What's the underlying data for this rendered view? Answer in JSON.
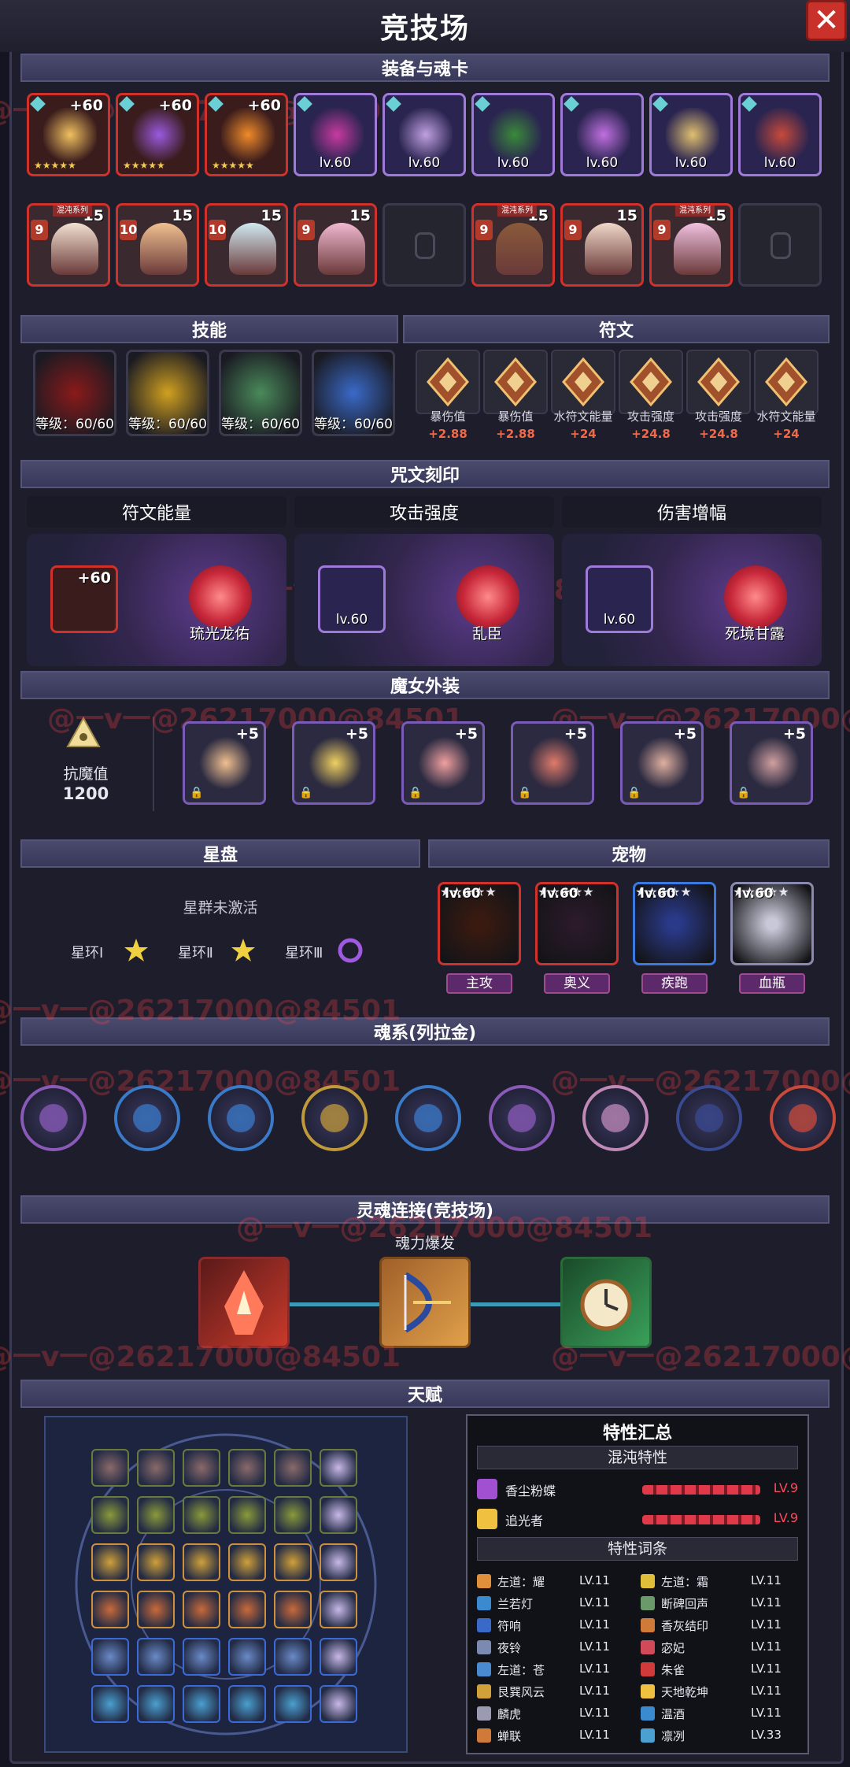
{
  "title": "竞技场",
  "colors": {
    "accent_red": "#d0312a",
    "panel": "#1d1d2b",
    "section_header": "#4a4a6c"
  },
  "sections": {
    "equipment": "装备与魂卡",
    "skills": "技能",
    "runes": "符文",
    "engraving": "咒文刻印",
    "costume": "魔女外装",
    "star_disk": "星盘",
    "pet": "宠物",
    "soul_system": "魂系(列拉金)",
    "soul_link": "灵魂连接(竞技场)",
    "talent": "天赋"
  },
  "equipment": [
    {
      "kind": "weapon",
      "label": "+60"
    },
    {
      "kind": "orb",
      "label": "+60"
    },
    {
      "kind": "flame",
      "label": "+60"
    },
    {
      "kind": "staff",
      "label": "lv.60"
    },
    {
      "kind": "axe",
      "label": "lv.60"
    },
    {
      "kind": "warrior",
      "label": "lv.60"
    },
    {
      "kind": "potion",
      "label": "lv.60"
    },
    {
      "kind": "ring",
      "label": "lv.60"
    },
    {
      "kind": "boot",
      "label": "lv.60"
    }
  ],
  "heroes": [
    {
      "rank": "9",
      "count": "15",
      "tag": "混沌系列"
    },
    {
      "rank": "10",
      "count": "15",
      "tag": ""
    },
    {
      "rank": "10",
      "count": "15",
      "tag": ""
    },
    {
      "rank": "9",
      "count": "15",
      "tag": ""
    },
    {
      "rank": "",
      "count": "",
      "tag": ""
    },
    {
      "rank": "9",
      "count": "15",
      "tag": "混沌系列"
    },
    {
      "rank": "9",
      "count": "15",
      "tag": ""
    },
    {
      "rank": "9",
      "count": "15",
      "tag": "混沌系列"
    },
    {
      "rank": "",
      "count": "",
      "tag": ""
    }
  ],
  "skills": [
    {
      "level": "等级：60/60"
    },
    {
      "level": "等级：60/60"
    },
    {
      "level": "等级：60/60"
    },
    {
      "level": "等级：60/60"
    }
  ],
  "runes": [
    {
      "name": "暴伤值",
      "value": "+2.88"
    },
    {
      "name": "暴伤值",
      "value": "+2.88"
    },
    {
      "name": "水符文能量",
      "value": "+24"
    },
    {
      "name": "攻击强度",
      "value": "+24.8"
    },
    {
      "name": "攻击强度",
      "value": "+24.8"
    },
    {
      "name": "水符文能量",
      "value": "+24"
    }
  ],
  "engravings": [
    {
      "header": "符文能量",
      "item_label": "+60",
      "seal": "琉光龙佑"
    },
    {
      "header": "攻击强度",
      "item_label": "lv.60",
      "seal": "乱臣"
    },
    {
      "header": "伤害增幅",
      "item_label": "lv.60",
      "seal": "死境甘露"
    }
  ],
  "costume": {
    "resist_label": "抗魔值",
    "resist_value": "1200",
    "items": [
      "+5",
      "+5",
      "+5",
      "+5",
      "+5",
      "+5"
    ]
  },
  "star_disk": {
    "status": "星群未激活",
    "rings": [
      "星环Ⅰ",
      "星环Ⅱ",
      "星环Ⅲ"
    ]
  },
  "pets": [
    {
      "level": "lv.60",
      "tag": "主攻"
    },
    {
      "level": "lv.60",
      "tag": "奥义"
    },
    {
      "level": "lv.60",
      "tag": "疾跑"
    },
    {
      "level": "lv.60",
      "tag": "血瓶"
    }
  ],
  "soul_link": {
    "label": "魂力爆发"
  },
  "traits": {
    "title": "特性汇总",
    "chaos_header": "混沌特性",
    "chaos": [
      {
        "name": "香尘粉蝶",
        "level": "LV.9"
      },
      {
        "name": "追光者",
        "level": "LV.9"
      }
    ],
    "entries_header": "特性词条",
    "entries": [
      {
        "name": "左道：耀",
        "level": "LV.11"
      },
      {
        "name": "左道：霜",
        "level": "LV.11"
      },
      {
        "name": "兰若灯",
        "level": "LV.11"
      },
      {
        "name": "断碑回声",
        "level": "LV.11"
      },
      {
        "name": "符响",
        "level": "LV.11"
      },
      {
        "name": "香灰结印",
        "level": "LV.11"
      },
      {
        "name": "夜铃",
        "level": "LV.11"
      },
      {
        "name": "宓妃",
        "level": "LV.11"
      },
      {
        "name": "左道：苍",
        "level": "LV.11"
      },
      {
        "name": "朱雀",
        "level": "LV.11"
      },
      {
        "name": "艮巽风云",
        "level": "LV.11"
      },
      {
        "name": "天地乾坤",
        "level": "LV.11"
      },
      {
        "name": "麟虎",
        "level": "LV.11"
      },
      {
        "name": "温酒",
        "level": "LV.11"
      },
      {
        "name": "蝉联",
        "level": "LV.11"
      },
      {
        "name": "凛冽",
        "level": "LV.33"
      }
    ]
  },
  "watermark": "@一v一@26217000@84501"
}
